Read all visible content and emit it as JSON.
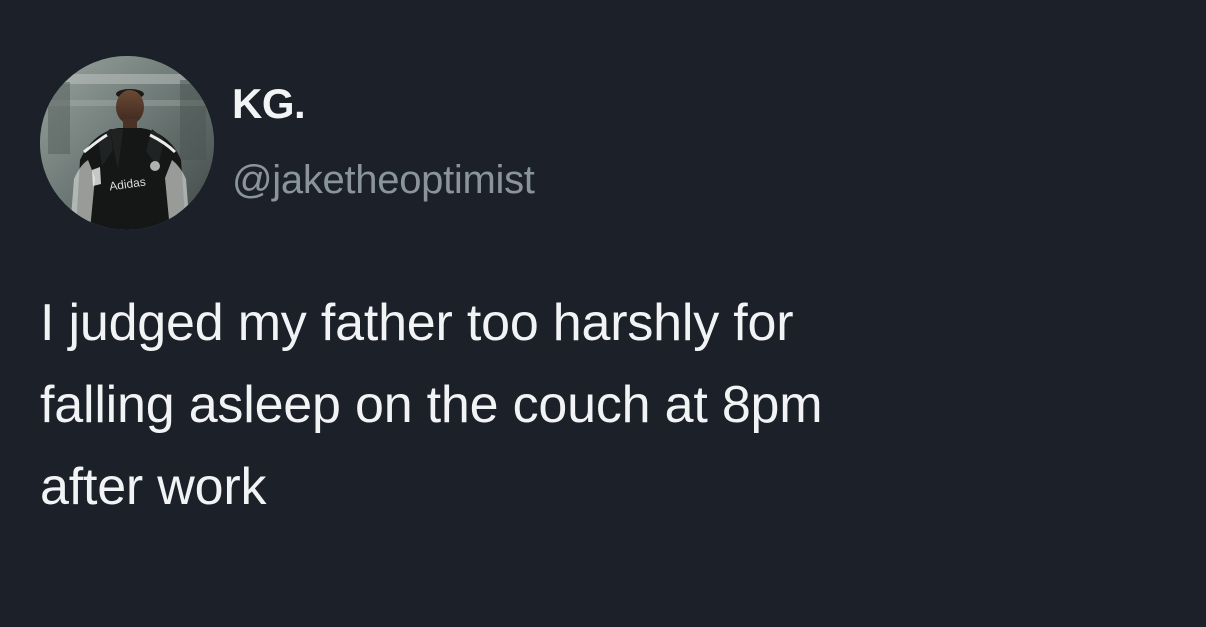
{
  "author": {
    "display_name": "KG.",
    "handle": "@jaketheoptimist",
    "avatar_icon": "profile-photo-avatar"
  },
  "tweet": {
    "lines": [
      "I judged my father too harshly for",
      "falling asleep on the couch at 8pm",
      "after work"
    ]
  },
  "colors": {
    "background": "#1c2028",
    "name_text": "#f3f4f6",
    "handle_text": "#8a949c",
    "body_text": "#f1f3f5"
  }
}
